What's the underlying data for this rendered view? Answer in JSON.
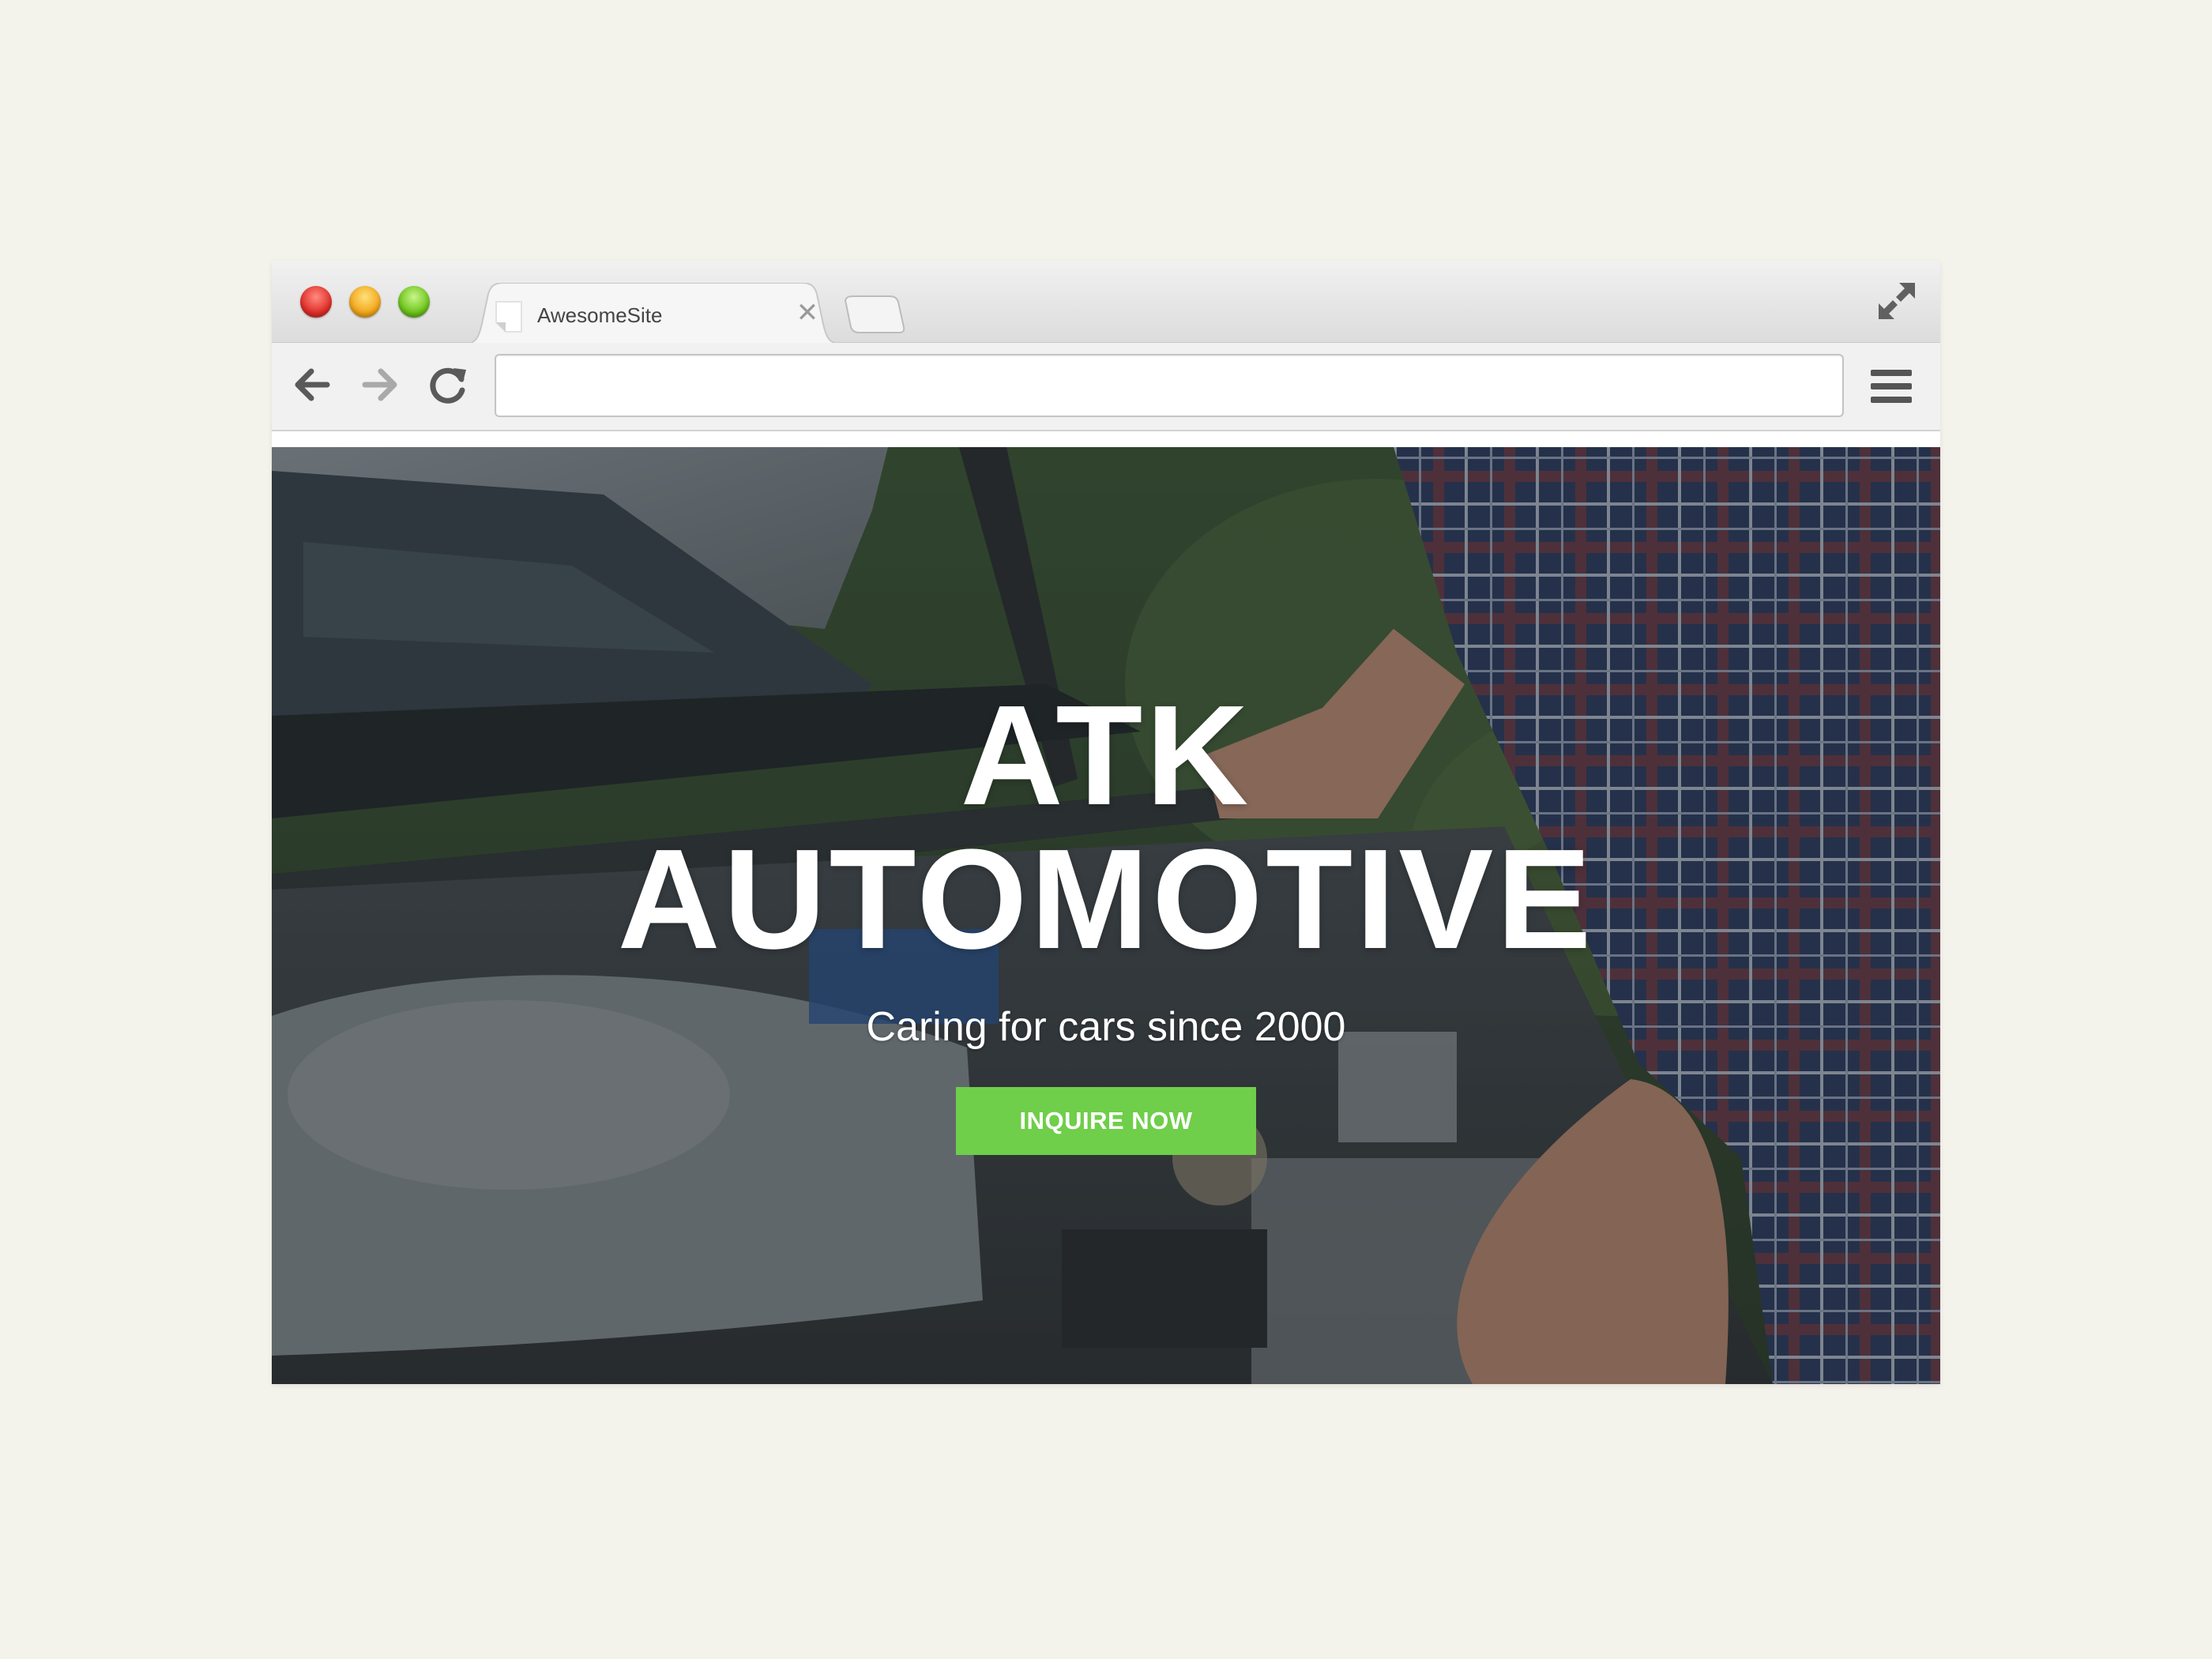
{
  "browser": {
    "tab": {
      "title": "AwesomeSite",
      "close_glyph": "✕",
      "favicon_icon": "page-icon"
    },
    "window_controls": [
      "close-light",
      "minimize-light",
      "zoom-light"
    ],
    "toolbar": {
      "back_icon": "arrow-left-icon",
      "forward_icon": "arrow-right-icon",
      "reload_icon": "reload-icon",
      "menu_icon": "hamburger-menu-icon",
      "address": {
        "value": "",
        "placeholder": ""
      }
    },
    "fullscreen_icon": "expand-icon"
  },
  "hero": {
    "title_line1": "ATK",
    "title_line2": "AUTOMOTIVE",
    "subtitle": "Caring for cars since 2000",
    "cta_label": "INQUIRE NOW",
    "background_image": "photo of a person in a plaid shirt leaning over an open car engine bay"
  },
  "colors": {
    "page_background": "#f3f3eb",
    "cta_green": "#6fce4a",
    "hero_text": "#ffffff",
    "chrome_bar": "#f1f1f1"
  }
}
